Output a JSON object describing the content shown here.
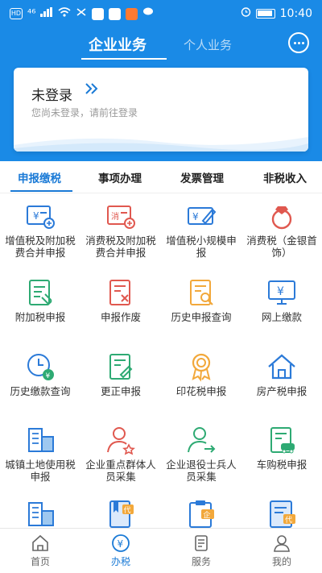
{
  "status_bar": {
    "left_badge": "HD",
    "signal": "⁴⁶",
    "time": "10:40"
  },
  "header": {
    "tabs": [
      {
        "label": "企业业务",
        "active": true
      },
      {
        "label": "个人业务",
        "active": false
      }
    ],
    "message_icon": "chat-bubble-icon"
  },
  "login_card": {
    "title": "未登录",
    "arrow": "»",
    "subtitle": "您尚未登录，请前往登录"
  },
  "category_tabs": [
    {
      "label": "申报缴税",
      "active": true
    },
    {
      "label": "事项办理",
      "active": false
    },
    {
      "label": "发票管理",
      "active": false
    },
    {
      "label": "非税收入",
      "active": false
    }
  ],
  "grid_items": [
    {
      "label": "增值税及附加税费合并申报",
      "icon": "yuan-card-plus-icon"
    },
    {
      "label": "消费税及附加税费合并申报",
      "icon": "consume-card-plus-icon"
    },
    {
      "label": "增值税小规模申报",
      "icon": "yuan-card-pen-icon"
    },
    {
      "label": "消费税（金银首饰）",
      "icon": "ring-icon"
    },
    {
      "label": "附加税申报",
      "icon": "document-paperclip-icon"
    },
    {
      "label": "申报作废",
      "icon": "document-cancel-icon"
    },
    {
      "label": "历史申报查询",
      "icon": "document-search-icon"
    },
    {
      "label": "网上缴款",
      "icon": "monitor-yuan-icon"
    },
    {
      "label": "历史缴款查询",
      "icon": "clock-yuan-icon"
    },
    {
      "label": "更正申报",
      "icon": "document-edit-icon"
    },
    {
      "label": "印花税申报",
      "icon": "award-ribbon-icon"
    },
    {
      "label": "房产税申报",
      "icon": "house-icon"
    },
    {
      "label": "城镇土地使用税申报",
      "icon": "buildings-icon"
    },
    {
      "label": "企业重点群体人员采集",
      "icon": "person-star-icon"
    },
    {
      "label": "企业退役士兵人员采集",
      "icon": "person-arrow-icon"
    },
    {
      "label": "车购税申报",
      "icon": "document-car-icon"
    },
    {
      "label": "",
      "icon": "buildings-icon"
    },
    {
      "label": "",
      "icon": "book-dai-icon"
    },
    {
      "label": "",
      "icon": "clipboard-qi-icon"
    },
    {
      "label": "",
      "icon": "document-dai-icon"
    }
  ],
  "bottom_nav": [
    {
      "label": "首页",
      "icon": "home-icon",
      "active": false
    },
    {
      "label": "办税",
      "icon": "tax-yuan-icon",
      "active": true
    },
    {
      "label": "服务",
      "icon": "service-icon",
      "active": false
    },
    {
      "label": "我的",
      "icon": "user-icon",
      "active": false
    }
  ],
  "colors": {
    "primary": "#1a8ae6",
    "icon_blue": "#2b7ad8",
    "icon_red": "#e0584f",
    "icon_green": "#2eaa73",
    "icon_yellow": "#f2a83b"
  }
}
